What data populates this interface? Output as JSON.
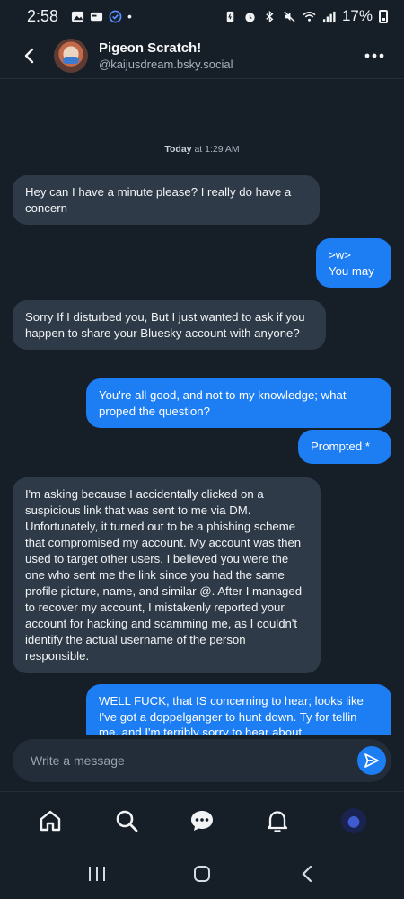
{
  "status_bar": {
    "time": "2:58",
    "battery_percent": "17%"
  },
  "header": {
    "display_name": "Pigeon Scratch!",
    "handle": "@kaijusdream.bsky.social"
  },
  "chat": {
    "date_day": "Today",
    "date_time": "at 1:29 AM",
    "messages": [
      {
        "direction": "incoming",
        "text": "Hey can I have a minute please? I really do have a concern"
      },
      {
        "direction": "outgoing",
        "line1": ">w>",
        "line2": "You may"
      },
      {
        "direction": "incoming",
        "text": "Sorry If I disturbed you, But I just wanted to ask if you happen to share your Bluesky account with anyone?"
      },
      {
        "direction": "outgoing",
        "text": "You're all good, and not to my knowledge; what proped the question?"
      },
      {
        "direction": "outgoing",
        "text": "Prompted *"
      },
      {
        "direction": "incoming",
        "text": "I'm asking because I accidentally clicked on a suspicious link that was sent to me via DM. Unfortunately, it turned out to be a phishing scheme that compromised my account. My account was then used to target other users. I believed you were the one who sent me the link since you had the same profile picture, name, and similar @. After I managed to recover my account, I mistakenly reported your account for hacking and scamming me, as I couldn't identify the actual username of the person responsible."
      },
      {
        "direction": "outgoing",
        "text": "WELL FUCK, that IS concerning to hear; looks like I've got a doppelganger to hunt down. Ty for tellin me, and I'm terribly sorry to hear about"
      }
    ]
  },
  "composer": {
    "placeholder": "Write a message"
  },
  "colors": {
    "background": "#161e27",
    "incoming_bubble": "#2e3a47",
    "outgoing_bubble": "#1d7df2"
  },
  "nav_icons": [
    "home-icon",
    "search-icon",
    "chat-icon",
    "bell-icon",
    "profile-avatar"
  ]
}
